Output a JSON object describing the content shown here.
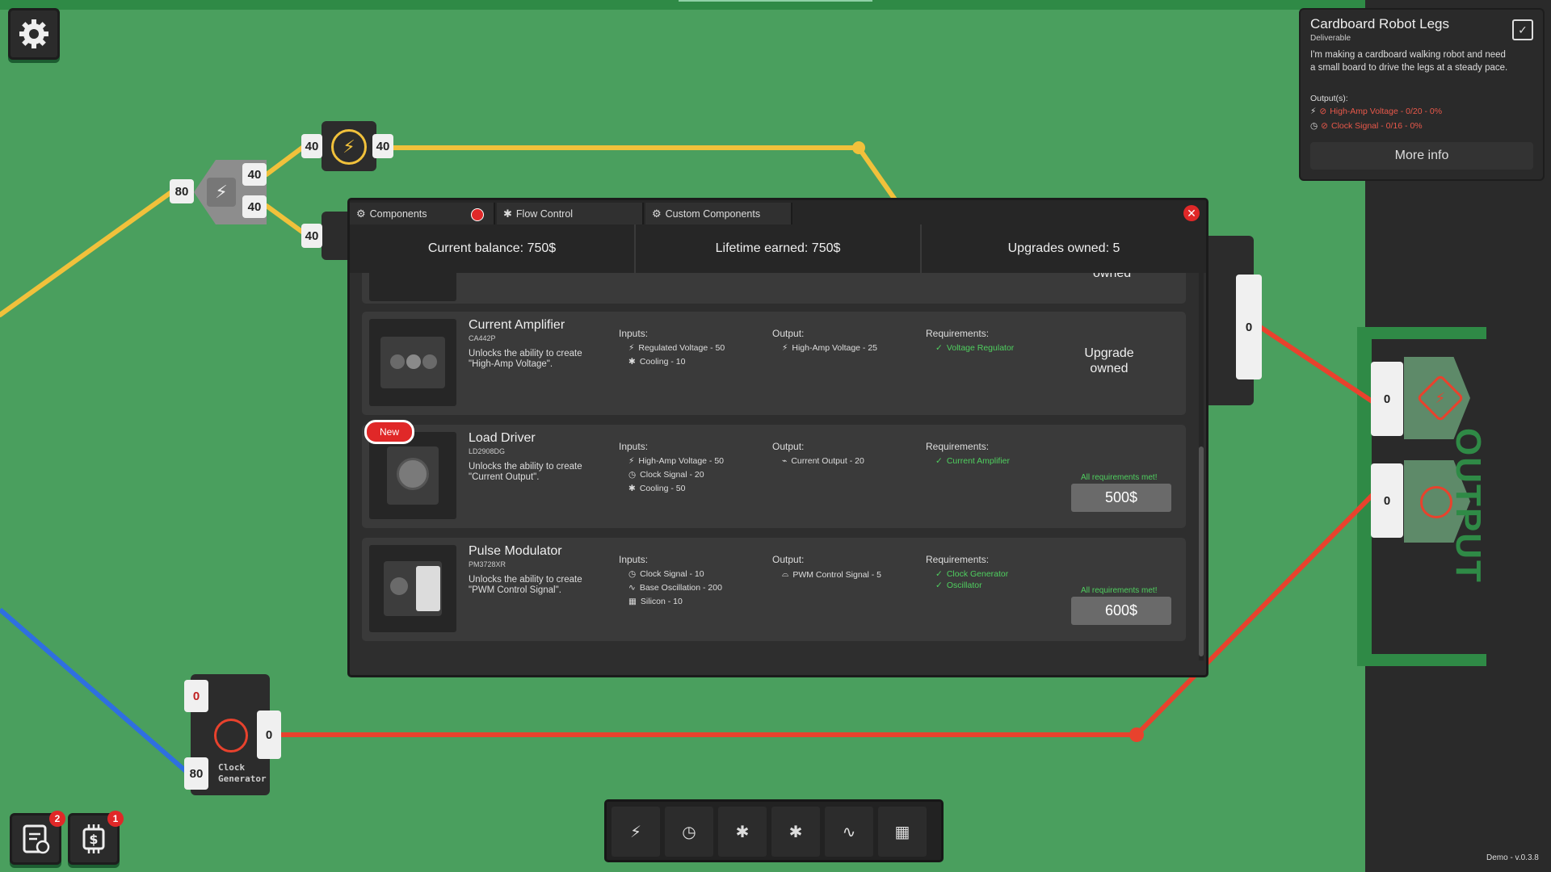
{
  "colors": {
    "board": "#4a9f5e",
    "wire_yellow": "#f1c13b",
    "wire_red": "#e8422d",
    "wire_blue": "#2f6fe0",
    "panel": "#2e2e2e",
    "ok_green": "#4fcf5f",
    "error_red": "#e8584a"
  },
  "board": {
    "splitter": {
      "input": "80",
      "out_a": "40",
      "out_b": "40"
    },
    "power_top": {
      "left": "40",
      "right": "40"
    },
    "power_bottom": {
      "left": "40"
    },
    "right_chip": {
      "value": "0"
    },
    "clock_generator": {
      "title_line1": "Clock",
      "title_line2": "Generator",
      "top_input": "0",
      "bottom_input": "80",
      "output": "0"
    },
    "output_zone": {
      "label": "OUTPUT",
      "slot1_value": "0",
      "slot2_value": "0",
      "slot1_icon": "bolt-icon",
      "slot2_icon": "clock-icon"
    }
  },
  "quest": {
    "title": "Cardboard Robot Legs",
    "subtitle": "Deliverable",
    "description": "I'm making a cardboard walking robot and need a small board to drive the legs at a steady pace.",
    "outputs_label": "Output(s):",
    "outputs": [
      {
        "icon": "bolt-icon",
        "text": "High-Amp Voltage - 0/20 - 0%"
      },
      {
        "icon": "clock-icon",
        "text": "Clock Signal - 0/16 - 0%"
      }
    ],
    "more_info": "More info"
  },
  "shop": {
    "tabs": [
      {
        "label": "Components"
      },
      {
        "label": "Flow Control"
      },
      {
        "label": "Custom Components"
      }
    ],
    "stats": {
      "balance": "Current balance: 750$",
      "lifetime": "Lifetime earned: 750$",
      "upgrades": "Upgrades owned: 5"
    },
    "partial_card_text": "owned",
    "cards": [
      {
        "name": "Current Amplifier",
        "code": "CA442P",
        "desc": "Unlocks the ability to create \"High-Amp Voltage\".",
        "inputs_label": "Inputs:",
        "inputs": [
          {
            "icon": "bolt-icon",
            "text": "Regulated Voltage - 50"
          },
          {
            "icon": "snowflake-icon",
            "text": "Cooling - 10"
          }
        ],
        "output_label": "Output:",
        "outputs": [
          {
            "icon": "bolt-icon",
            "text": "High-Amp Voltage - 25"
          }
        ],
        "req_label": "Requirements:",
        "requirements": [
          {
            "text": "Voltage Regulator"
          }
        ],
        "status_line1": "Upgrade",
        "status_line2": "owned"
      },
      {
        "name": "Load Driver",
        "code": "LD2908DG",
        "badge": "New",
        "desc": "Unlocks the ability to create \"Current Output\".",
        "inputs_label": "Inputs:",
        "inputs": [
          {
            "icon": "bolt-icon",
            "text": "High-Amp Voltage - 50"
          },
          {
            "icon": "clock-icon",
            "text": "Clock Signal - 20"
          },
          {
            "icon": "snowflake-icon",
            "text": "Cooling - 50"
          }
        ],
        "output_label": "Output:",
        "outputs": [
          {
            "icon": "current-icon",
            "text": "Current Output - 20"
          }
        ],
        "req_label": "Requirements:",
        "requirements": [
          {
            "text": "Current Amplifier"
          }
        ],
        "met": "All requirements met!",
        "price": "500$"
      },
      {
        "name": "Pulse Modulator",
        "code": "PM3728XR",
        "desc": "Unlocks the ability to create \"PWM Control Signal\".",
        "inputs_label": "Inputs:",
        "inputs": [
          {
            "icon": "clock-icon",
            "text": "Clock Signal - 10"
          },
          {
            "icon": "wave-icon",
            "text": "Base Oscillation - 200"
          },
          {
            "icon": "chip-icon",
            "text": "Silicon - 10"
          }
        ],
        "output_label": "Output:",
        "outputs": [
          {
            "icon": "pwm-icon",
            "text": "PWM Control Signal - 5"
          }
        ],
        "req_label": "Requirements:",
        "requirements": [
          {
            "text": "Clock Generator"
          },
          {
            "text": "Oscillator"
          }
        ],
        "met": "All requirements met!",
        "price": "600$"
      }
    ]
  },
  "hud": {
    "contracts_badge": "2",
    "shop_badge": "1"
  },
  "version": "Demo - v.0.3.8"
}
